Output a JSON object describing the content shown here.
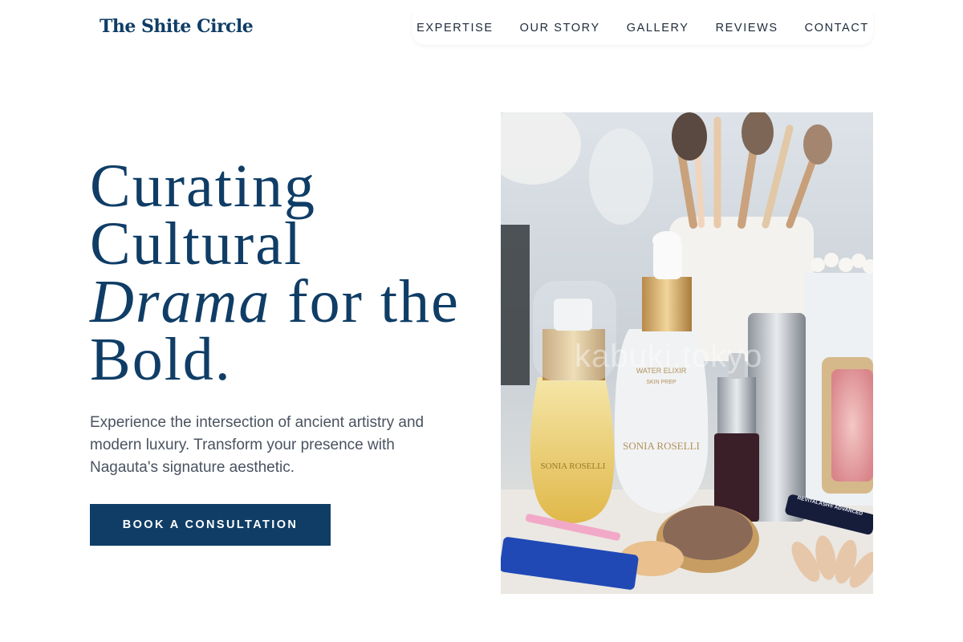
{
  "header": {
    "logo": "The Shite Circle",
    "nav": [
      "EXPERTISE",
      "OUR STORY",
      "GALLERY",
      "REVIEWS",
      "CONTACT"
    ]
  },
  "hero": {
    "headline_line1": "Curating",
    "headline_line2": "Cultural",
    "headline_em": "Drama",
    "headline_line3_rest": " for the",
    "headline_line4": "Bold.",
    "lede": "Experience the intersection of ancient artistry and modern luxury. Transform your presence with Nagauta's signature aesthetic.",
    "cta_label": "BOOK A CONSULTATION",
    "image": {
      "watermark": "kabuki.tokyo",
      "bottle_left_brand": "SONIA ROSELLI",
      "bottle_center_line1": "WATER ELIXIR",
      "bottle_center_line2": "SKIN PREP",
      "bottle_center_brand": "SONIA ROSELLI",
      "tube_label": "REVITALASH® ADVANCED"
    }
  },
  "colors": {
    "brand": "#0f3d66",
    "text_muted": "#4a5360",
    "background": "#ffffff"
  }
}
